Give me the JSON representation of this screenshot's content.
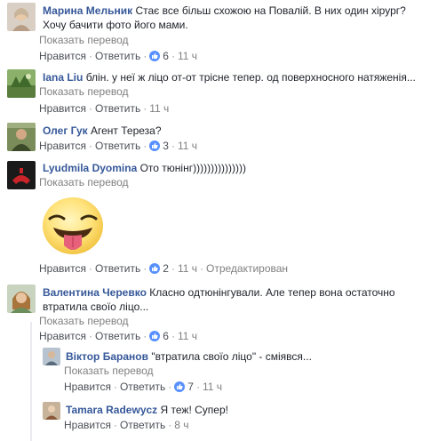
{
  "translate_label": "Показать перевод",
  "like_label": "Нравится",
  "reply_label": "Ответить",
  "comments": [
    {
      "name": "Марина Мельник",
      "line1": "Стає все більш схожою на Повалій. В них один хірург?",
      "line2": "Хочу бачити фото його мами.",
      "likes": "6",
      "time": "11 ч"
    },
    {
      "name": "Iana Liu",
      "line1": "блін. у неї ж ліцо от-от трісне тепер. од поверхносного натяженія...",
      "time": "11 ч"
    },
    {
      "name": "Олег Гук",
      "line1": "Агент Тереза?",
      "likes": "3",
      "time": "11 ч"
    },
    {
      "name": "Lyudmila Dyomina",
      "line1": "Ото тюнінг)))))))))))))))",
      "likes": "2",
      "time": "11 ч",
      "edited": "Отредактирован"
    },
    {
      "name": "Валентина Черевко",
      "line1": "Класно одтюнінгували. Але тепер вона остаточно",
      "line2": "втратила своїо ліцо...",
      "likes": "6",
      "time": "11 ч"
    }
  ],
  "replies": [
    {
      "name": "Віктор Баранов",
      "line1": "\"втратила своїо ліцо\" - сміявся...",
      "likes": "7",
      "time": "11 ч"
    },
    {
      "name": "Tamara Radewycz",
      "line1": "Я теж! Супер!",
      "time": "8 ч"
    }
  ],
  "colors": {
    "name": "#365899",
    "meta": "#7f7f7f",
    "like_badge": "#5890ff"
  },
  "icons": [
    "thumbs-up-icon",
    "tongue-emoji-sticker"
  ]
}
